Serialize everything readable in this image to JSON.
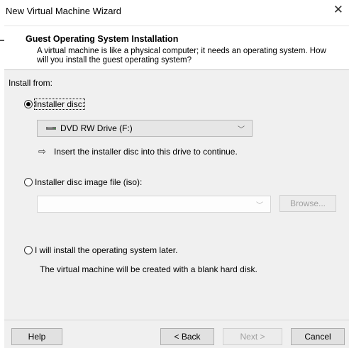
{
  "window": {
    "title": "New Virtual Machine Wizard",
    "close_glyph": "✕"
  },
  "header": {
    "title": "Guest Operating System Installation",
    "subtitle": "A virtual machine is like a physical computer; it needs an operating system. How will you install the guest operating system?"
  },
  "install_from": {
    "label": "Install from:",
    "option_disc": {
      "label": "Installer disc:",
      "selected": true
    },
    "drive_select": {
      "value": "DVD RW Drive (F:)",
      "icon": "dvd-drive-icon"
    },
    "hint": {
      "icon": "arrow-right-icon",
      "text": "Insert the installer disc into this drive to continue."
    },
    "option_iso": {
      "label": "Installer disc image file (iso):",
      "selected": false
    },
    "iso_select": {
      "value": ""
    },
    "browse_label": "Browse...",
    "option_later": {
      "label": "I will install the operating system later.",
      "selected": false
    },
    "later_note": "The virtual machine will be created with a blank hard disk."
  },
  "footer": {
    "help_label": "Help",
    "back_label": "< Back",
    "next_label": "Next >",
    "cancel_label": "Cancel"
  }
}
